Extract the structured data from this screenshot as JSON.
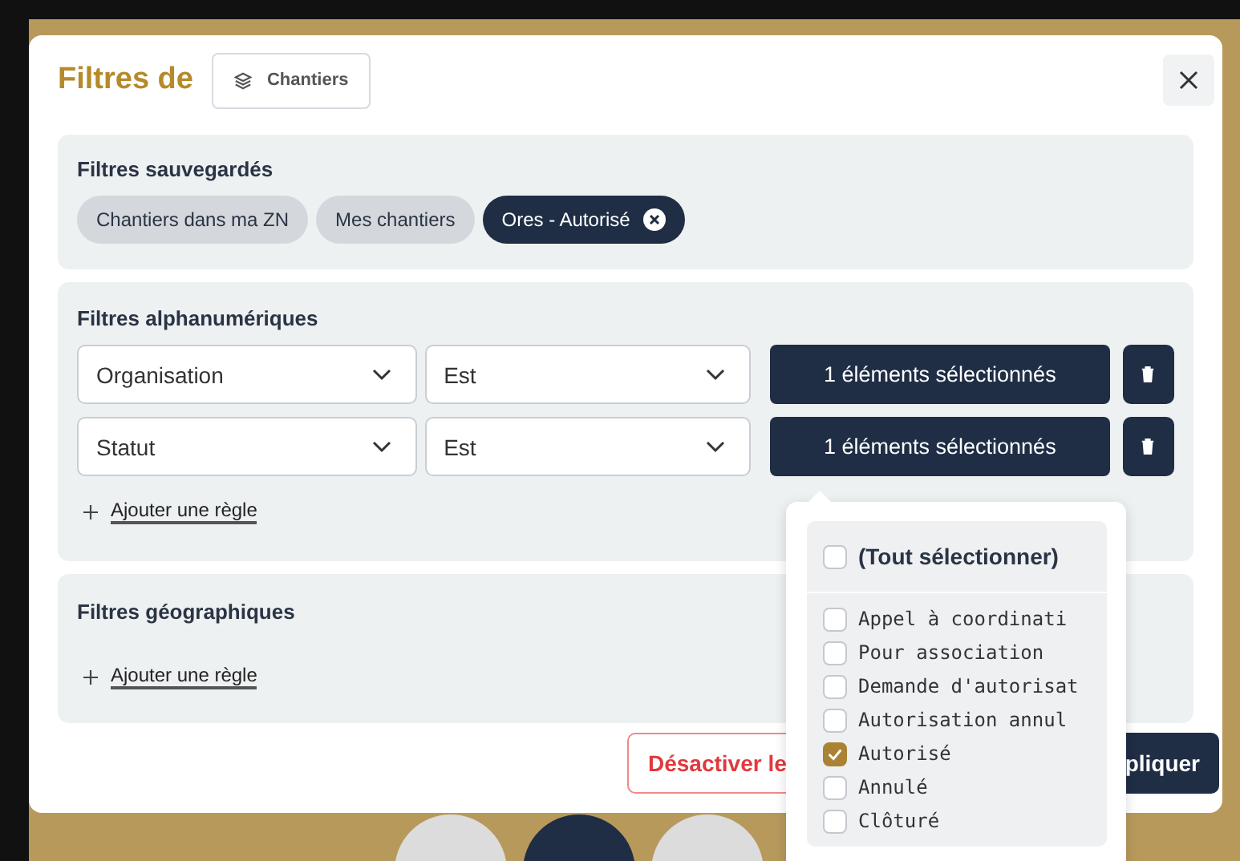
{
  "dialog": {
    "title": "Filtres de",
    "layer_button": "Chantiers"
  },
  "saved_filters": {
    "title": "Filtres sauvegardés",
    "chips": [
      {
        "label": "Chantiers dans ma ZN",
        "selected": false
      },
      {
        "label": "Mes chantiers",
        "selected": false
      },
      {
        "label": "Ores - Autorisé",
        "selected": true
      }
    ]
  },
  "alpha_filters": {
    "title": "Filtres alphanumériques",
    "rules": [
      {
        "field": "Organisation",
        "operator": "Est",
        "value": "1 éléments sélectionnés"
      },
      {
        "field": "Statut",
        "operator": "Est",
        "value": "1 éléments sélectionnés"
      }
    ],
    "add_rule": "Ajouter une règle"
  },
  "geo_filters": {
    "title": "Filtres géographiques",
    "add_rule": "Ajouter une règle"
  },
  "footer": {
    "deactivate_button": "Désactiver le",
    "apply_button": "pliquer"
  },
  "value_popup": {
    "select_all": {
      "label": "(Tout sélectionner)",
      "checked": false
    },
    "options": [
      {
        "label": "Appel à coordinati",
        "checked": false
      },
      {
        "label": "Pour association",
        "checked": false
      },
      {
        "label": "Demande d'autorisat",
        "checked": false
      },
      {
        "label": "Autorisation annul",
        "checked": false
      },
      {
        "label": "Autorisé",
        "checked": true
      },
      {
        "label": "Annulé",
        "checked": false
      },
      {
        "label": "Clôturé",
        "checked": false
      }
    ]
  }
}
